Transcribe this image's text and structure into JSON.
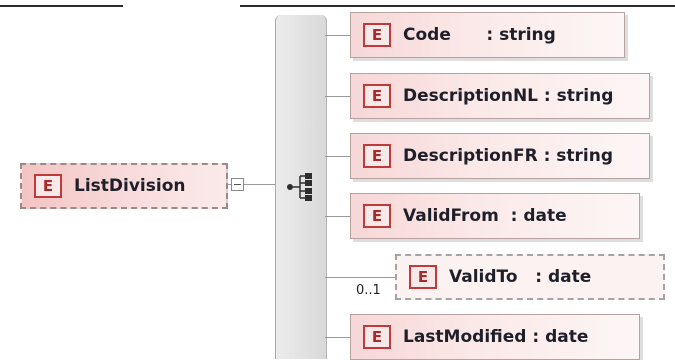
{
  "root": {
    "badge": "E",
    "name": "ListDivision"
  },
  "elements": [
    {
      "badge": "E",
      "label": "Code      : string"
    },
    {
      "badge": "E",
      "label": "DescriptionNL : string"
    },
    {
      "badge": "E",
      "label": "DescriptionFR : string"
    },
    {
      "badge": "E",
      "label": "ValidFrom  : date"
    },
    {
      "badge": "E",
      "label": "ValidTo   : date",
      "occurrence": "0..1"
    },
    {
      "badge": "E",
      "label": "LastModified : date"
    }
  ],
  "icons": {
    "collapse": "minus-box-icon",
    "sequence": "sequence-compositor-icon"
  }
}
